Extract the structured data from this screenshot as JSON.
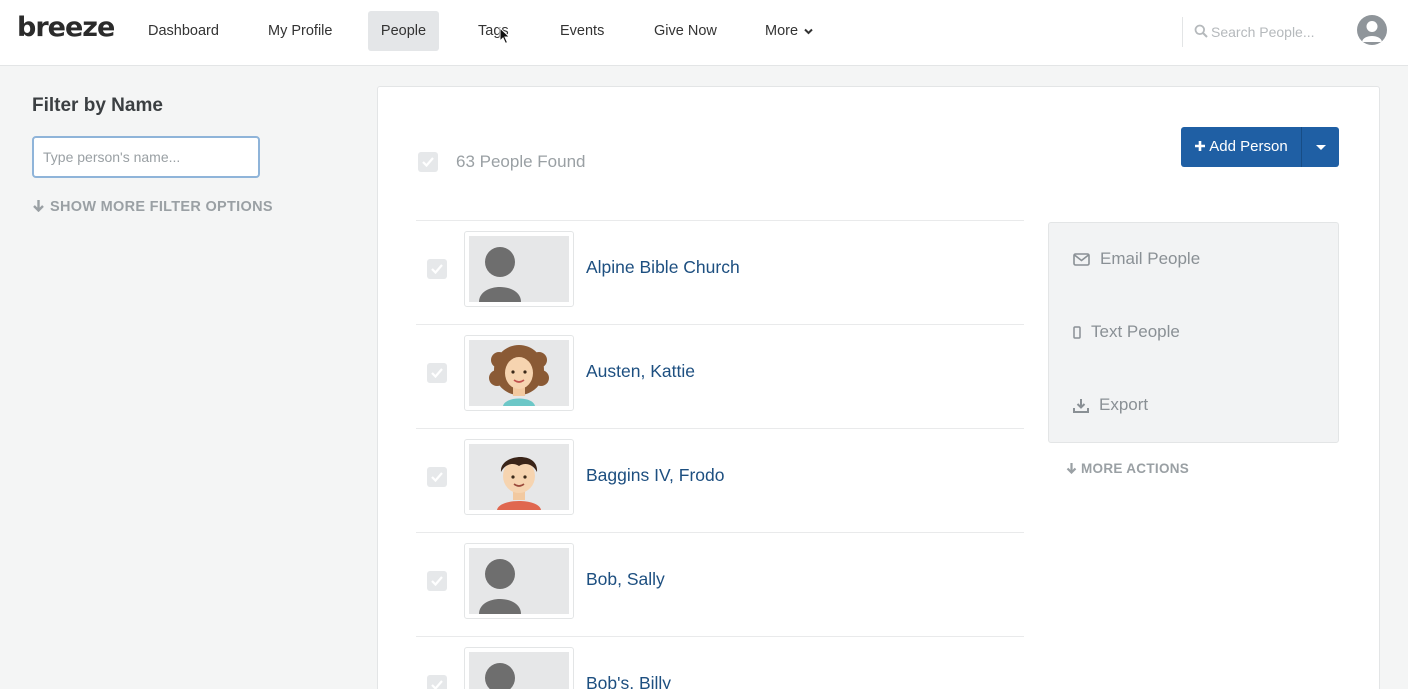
{
  "header": {
    "logo": "breeze",
    "nav": [
      {
        "label": "Dashboard"
      },
      {
        "label": "My Profile"
      },
      {
        "label": "People"
      },
      {
        "label": "Tags"
      },
      {
        "label": "Events"
      },
      {
        "label": "Give Now"
      },
      {
        "label": "More"
      }
    ],
    "search_placeholder": "Search People..."
  },
  "sidebar": {
    "title": "Filter by Name",
    "name_placeholder": "Type person's name...",
    "more_filters": "SHOW MORE FILTER OPTIONS"
  },
  "main": {
    "count_text": "63 People Found",
    "add_button": "Add Person",
    "people": [
      {
        "name": "Alpine Bible Church",
        "avatar": "default"
      },
      {
        "name": "Austen, Kattie",
        "avatar": "girl-curly-hair"
      },
      {
        "name": "Baggins IV, Frodo",
        "avatar": "boy-dark-hair"
      },
      {
        "name": "Bob, Sally",
        "avatar": "default"
      },
      {
        "name": "Bob's, Billy",
        "avatar": "default"
      }
    ],
    "actions": [
      {
        "label": "Email People",
        "icon": "envelope-icon"
      },
      {
        "label": "Text People",
        "icon": "mobile-phone-icon"
      },
      {
        "label": "Export",
        "icon": "download-icon"
      }
    ],
    "more_actions": "MORE ACTIONS"
  },
  "colors": {
    "accent": "#1f5fa4",
    "link": "#1d4f80"
  }
}
